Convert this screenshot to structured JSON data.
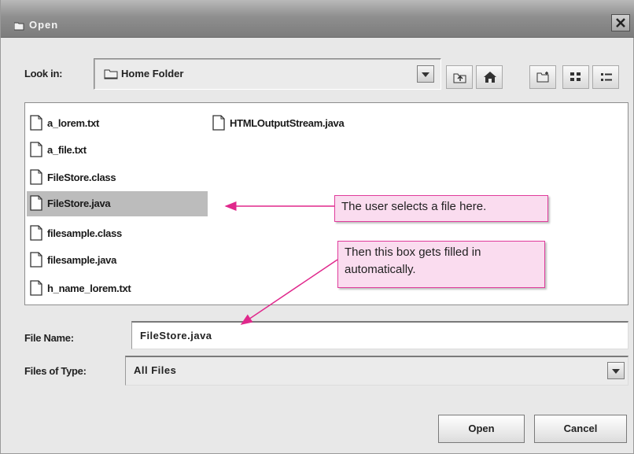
{
  "dialog": {
    "title": "Open",
    "look_in_label": "Look in:",
    "look_in_value": "Home Folder"
  },
  "files": [
    {
      "name": "a_lorem.txt",
      "selected": false
    },
    {
      "name": "a_file.txt",
      "selected": false
    },
    {
      "name": "FileStore.class",
      "selected": false
    },
    {
      "name": "FileStore.java",
      "selected": true
    },
    {
      "name": "filesample.class",
      "selected": false
    },
    {
      "name": "filesample.java",
      "selected": false
    },
    {
      "name": "h_name_lorem.txt",
      "selected": false
    },
    {
      "name": "HTMLOutputStream.java",
      "selected": false
    }
  ],
  "form": {
    "file_name_label": "File Name:",
    "file_name_value": "FileStore.java",
    "file_type_label": "Files of Type:",
    "file_type_value": "All Files"
  },
  "buttons": {
    "open": "Open",
    "cancel": "Cancel"
  },
  "callouts": {
    "select_note": "The user selects a file here.",
    "autofill_line1": "Then this box gets filled in",
    "autofill_line2": "automatically."
  },
  "icons": {
    "title": "folder-open-icon",
    "close": "close-icon",
    "toolbar": [
      "up-one-level-icon",
      "home-icon",
      "new-folder-icon",
      "list-view-icon",
      "details-view-icon"
    ]
  },
  "colors": {
    "callout_fill": "#fadcef",
    "callout_border": "#e03c9c",
    "arrow": "#e0288c",
    "selection": "#bcbcbc"
  }
}
